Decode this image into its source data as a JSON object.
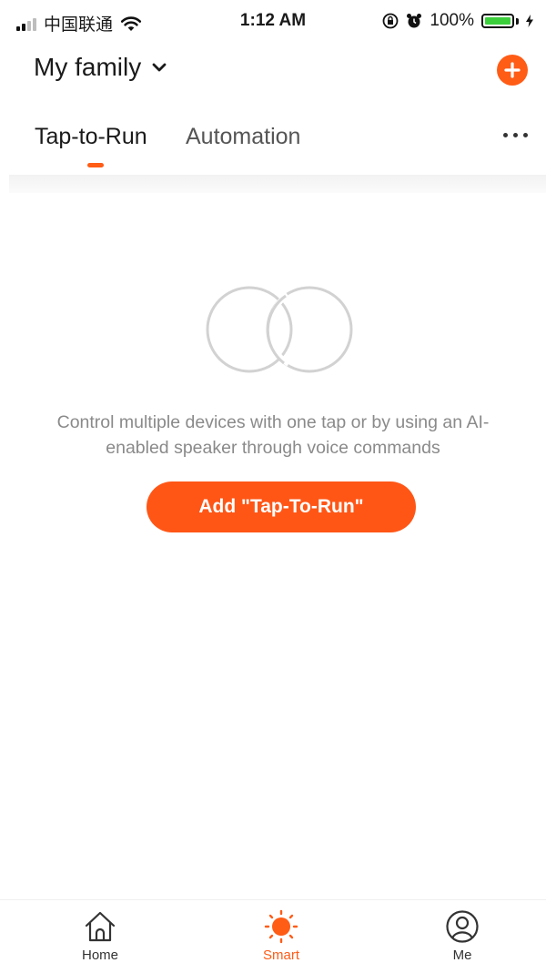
{
  "status_bar": {
    "carrier": "中国联通",
    "time": "1:12 AM",
    "battery_percent": "100%",
    "battery_level": 1.0,
    "icons": [
      "signal-icon",
      "wifi-icon",
      "orientation-lock-icon",
      "alarm-icon",
      "battery-icon",
      "charging-icon"
    ]
  },
  "header": {
    "title": "My family",
    "dropdown_icon": "chevron-down-icon",
    "add_icon": "plus-circle-icon",
    "accent_color": "#ff5c16"
  },
  "tabs": [
    {
      "label": "Tap-to-Run",
      "active": true
    },
    {
      "label": "Automation",
      "active": false
    }
  ],
  "more_icon": "more-horizontal-icon",
  "empty_state": {
    "icon": "overlapping-circles-icon",
    "message": "Control multiple devices with one tap or by using an AI-enabled speaker through voice commands",
    "button_label": "Add \"Tap-To-Run\""
  },
  "bottom_nav": [
    {
      "label": "Home",
      "icon": "home-icon",
      "active": false
    },
    {
      "label": "Smart",
      "icon": "sun-icon",
      "active": true
    },
    {
      "label": "Me",
      "icon": "user-circle-icon",
      "active": false
    }
  ]
}
